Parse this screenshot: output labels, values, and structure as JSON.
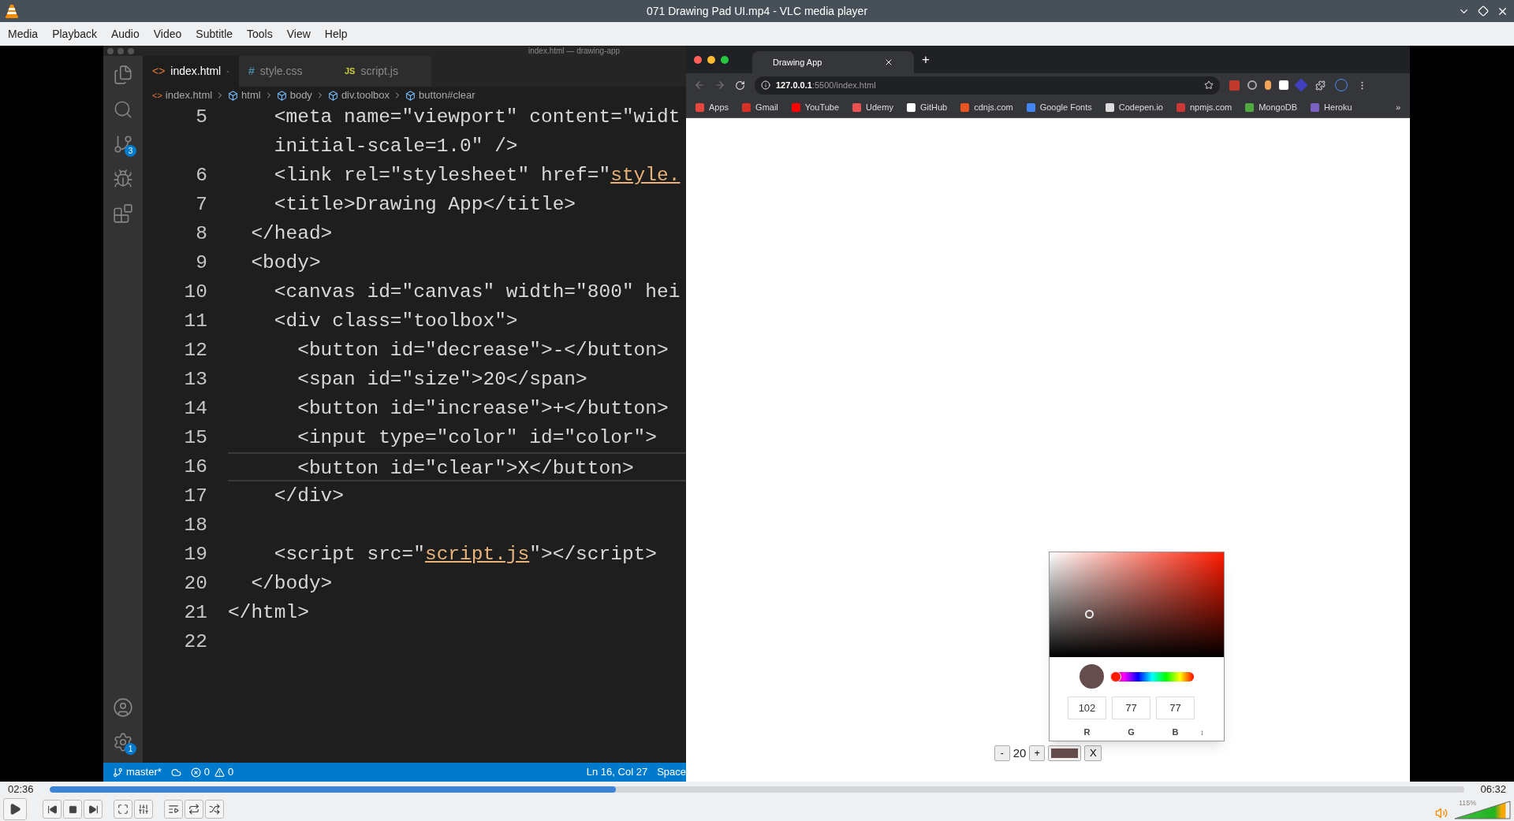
{
  "window": {
    "title": "071 Drawing Pad UI.mp4 - VLC media player"
  },
  "menu": [
    "Media",
    "Playback",
    "Audio",
    "Video",
    "Subtitle",
    "Tools",
    "View",
    "Help"
  ],
  "editor": {
    "title": "index.html — drawing-app",
    "activity_top": [
      {
        "kind": "files"
      },
      {
        "kind": "search"
      },
      {
        "kind": "source-control",
        "badge": "3"
      },
      {
        "kind": "run"
      },
      {
        "kind": "extensions"
      }
    ],
    "activity_bottom": [
      {
        "kind": "account"
      },
      {
        "kind": "settings",
        "badge": "1"
      }
    ],
    "tabs": [
      {
        "label": "index.html",
        "icon": "<>",
        "kind": "html",
        "selected": true
      },
      {
        "label": "style.css",
        "icon": "#",
        "kind": "css",
        "selected": false
      },
      {
        "label": "script.js",
        "icon": "JS",
        "kind": "js",
        "selected": false
      }
    ],
    "breadcrumbs": [
      {
        "label": "index.html",
        "kind": "file"
      },
      {
        "label": "html",
        "kind": "element"
      },
      {
        "label": "body",
        "kind": "element"
      },
      {
        "label": "div.toolbox",
        "kind": "element"
      },
      {
        "label": "button#clear",
        "kind": "element"
      }
    ],
    "lines": [
      {
        "number": "5",
        "current": false,
        "parts": [
          {
            "kind": "code",
            "text": "    <meta name=\"viewport\" content=\"widt"
          }
        ]
      },
      {
        "current": false,
        "parts": [
          {
            "kind": "code",
            "text": "    initial-scale=1.0\" />"
          }
        ]
      },
      {
        "number": "6",
        "current": false,
        "parts": [
          {
            "kind": "code",
            "text": "    <link rel=\"stylesheet\" href=\""
          },
          {
            "kind": "link",
            "text": "style."
          }
        ]
      },
      {
        "number": "7",
        "current": false,
        "parts": [
          {
            "kind": "code",
            "text": "    <title>Drawing App</title>"
          }
        ]
      },
      {
        "number": "8",
        "current": false,
        "parts": [
          {
            "kind": "code",
            "text": "  </head>"
          }
        ]
      },
      {
        "number": "9",
        "current": false,
        "parts": [
          {
            "kind": "code",
            "text": "  <body>"
          }
        ]
      },
      {
        "number": "10",
        "current": false,
        "parts": [
          {
            "kind": "code",
            "text": "    <canvas id=\"canvas\" width=\"800\" hei"
          }
        ]
      },
      {
        "number": "11",
        "current": false,
        "parts": [
          {
            "kind": "code",
            "text": "    <div class=\"toolbox\">"
          }
        ]
      },
      {
        "number": "12",
        "current": false,
        "parts": [
          {
            "kind": "code",
            "text": "      <button id=\"decrease\">-</button>"
          }
        ]
      },
      {
        "number": "13",
        "current": false,
        "parts": [
          {
            "kind": "code",
            "text": "      <span id=\"size\">20</span>"
          }
        ]
      },
      {
        "number": "14",
        "current": false,
        "parts": [
          {
            "kind": "code",
            "text": "      <button id=\"increase\">+</button>"
          }
        ]
      },
      {
        "number": "15",
        "current": false,
        "parts": [
          {
            "kind": "code",
            "text": "      <input type=\"color\" id=\"color\">"
          }
        ]
      },
      {
        "number": "16",
        "current": true,
        "parts": [
          {
            "kind": "code",
            "text": "      <button id=\"clear\">X</button>"
          }
        ]
      },
      {
        "number": "17",
        "current": false,
        "parts": [
          {
            "kind": "code",
            "text": "    </div>"
          }
        ]
      },
      {
        "number": "18",
        "current": false
      },
      {
        "number": "19",
        "current": false,
        "parts": [
          {
            "kind": "code",
            "text": "    <script src=\""
          },
          {
            "kind": "link",
            "text": "script.js"
          },
          {
            "kind": "code",
            "text": "\"></script>"
          }
        ]
      },
      {
        "number": "20",
        "current": false,
        "parts": [
          {
            "kind": "code",
            "text": "  </body>"
          }
        ]
      },
      {
        "number": "21",
        "current": false,
        "parts": [
          {
            "kind": "code",
            "text": "</html>"
          }
        ]
      },
      {
        "number": "22",
        "current": false
      }
    ],
    "status": {
      "branch": "master*",
      "errors": "0",
      "warnings": "0",
      "position": "Ln 16, Col 27",
      "indent": "Space"
    }
  },
  "browser": {
    "tab": "Drawing App",
    "new_tab": "+",
    "url": "**127.0.0.1**:5500/index.html",
    "bookmarks": [
      {
        "label": "Apps",
        "color": "#e8453c"
      },
      {
        "label": "Gmail",
        "color": "#d93025"
      },
      {
        "label": "YouTube",
        "color": "#ff0000"
      },
      {
        "label": "Udemy",
        "color": "#ec5252"
      },
      {
        "label": "GitHub",
        "color": "#ffffff"
      },
      {
        "label": "cdnjs.com",
        "color": "#e95420"
      },
      {
        "label": "Google Fonts",
        "color": "#4285f4"
      },
      {
        "label": "Codepen.io",
        "color": "#dddddd"
      },
      {
        "label": "npmjs.com",
        "color": "#cb3837"
      },
      {
        "label": "MongoDB",
        "color": "#4faa41"
      },
      {
        "label": "Heroku",
        "color": "#7b61c4"
      }
    ],
    "more": "»",
    "toolbox": {
      "decrease": "-",
      "size": "20",
      "increase": "+",
      "color": "#664d4d",
      "clear": "X"
    },
    "picker": {
      "level": 0,
      "values": [
        "102",
        "77",
        "77"
      ],
      "labels": [
        "R",
        "G",
        "B"
      ],
      "toggle": "↕"
    }
  },
  "seek": {
    "elapsed": "02:36",
    "total": "06:32",
    "level": 0.4
  },
  "volume": {
    "reading": "115%",
    "level": 0.92
  }
}
